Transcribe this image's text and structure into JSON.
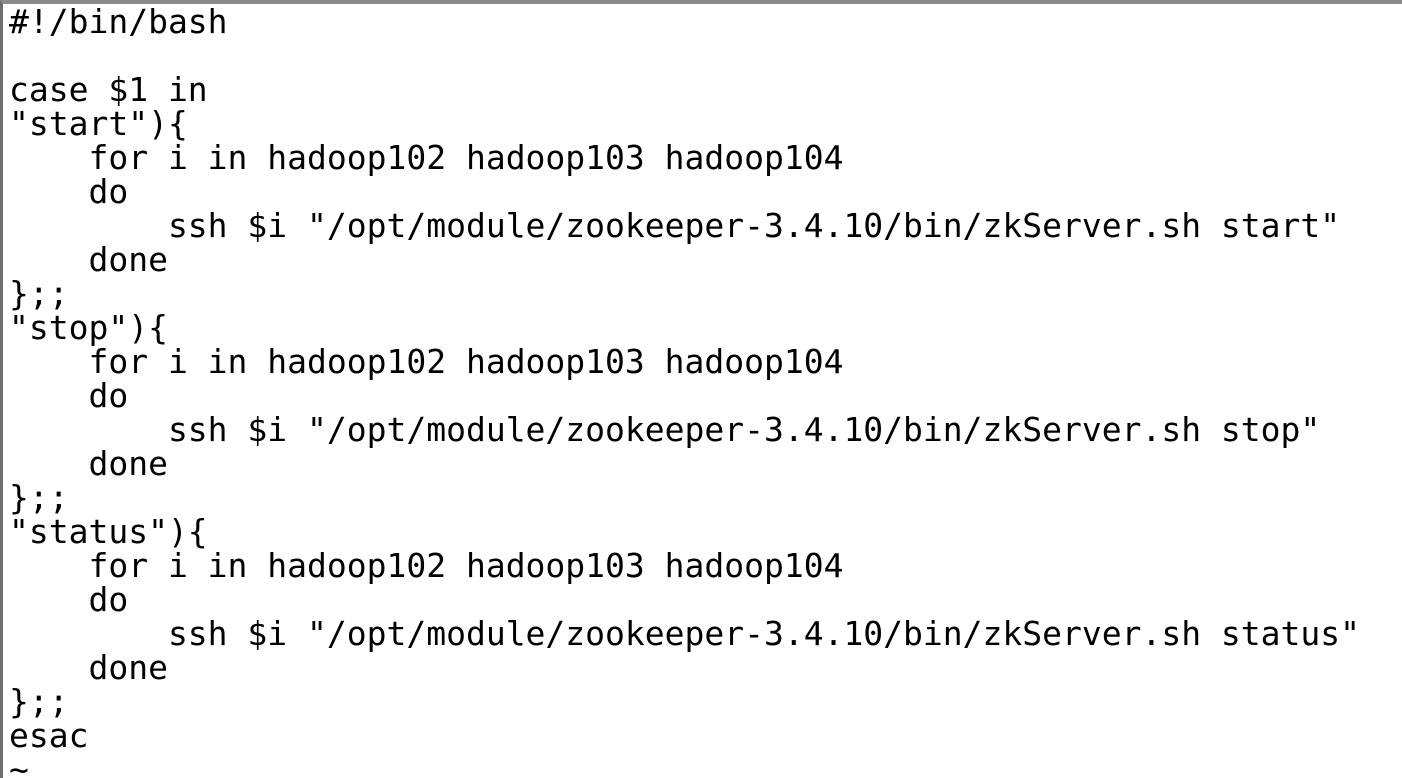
{
  "editor": {
    "lines": [
      "#!/bin/bash",
      "",
      "case $1 in",
      "\"start\"){",
      "    for i in hadoop102 hadoop103 hadoop104",
      "    do",
      "        ssh $i \"/opt/module/zookeeper-3.4.10/bin/zkServer.sh start\"",
      "    done",
      "};;",
      "\"stop\"){",
      "    for i in hadoop102 hadoop103 hadoop104",
      "    do",
      "        ssh $i \"/opt/module/zookeeper-3.4.10/bin/zkServer.sh stop\"",
      "    done",
      "};;",
      "\"status\"){",
      "    for i in hadoop102 hadoop103 hadoop104",
      "    do",
      "        ssh $i \"/opt/module/zookeeper-3.4.10/bin/zkServer.sh status\"",
      "    done",
      "};;",
      "esac",
      "~"
    ]
  }
}
